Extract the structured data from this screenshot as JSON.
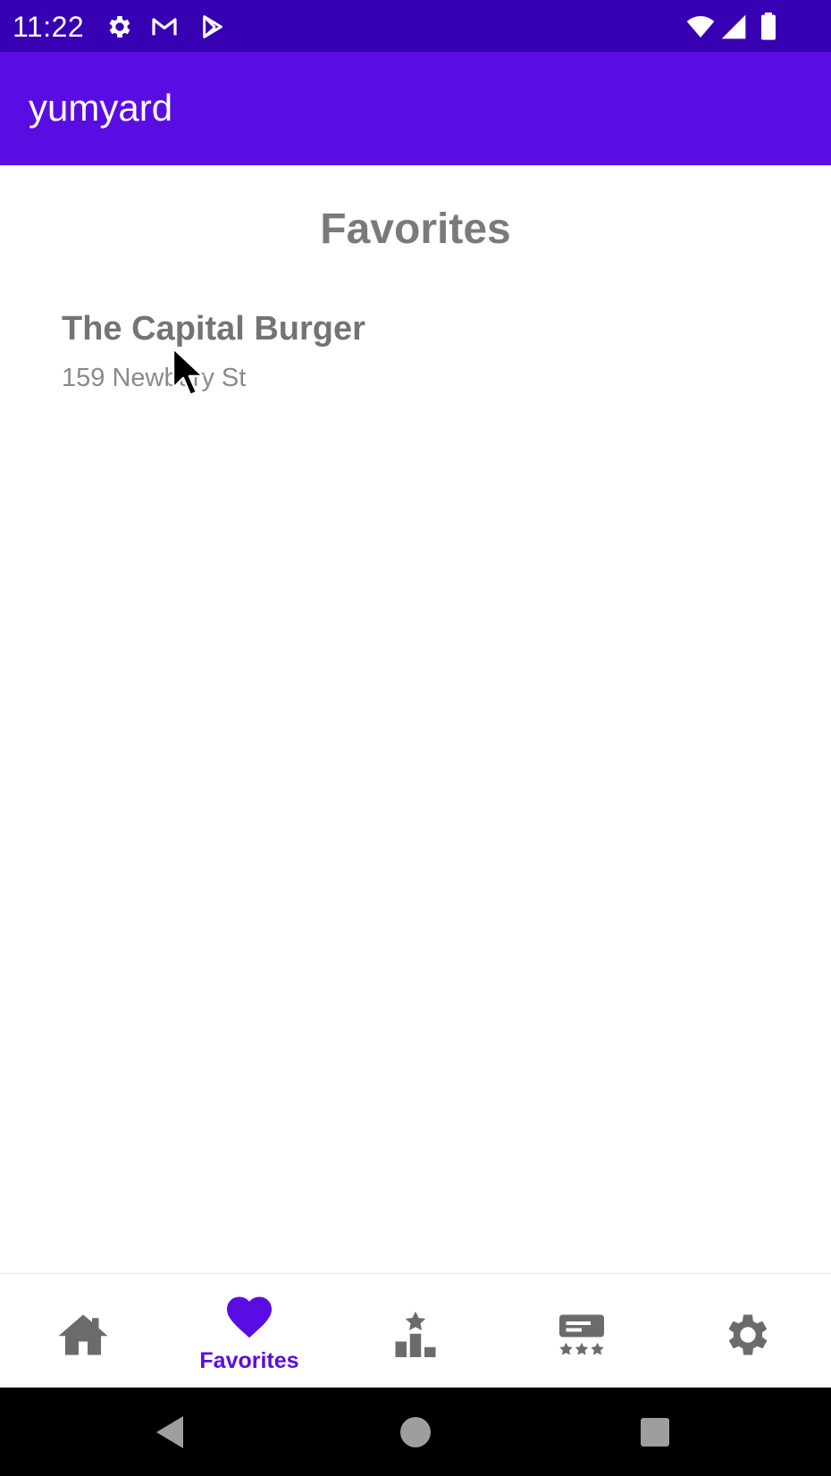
{
  "status_bar": {
    "time": "11:22",
    "icons": [
      "gear-icon",
      "gmail-icon",
      "play-store-icon",
      "wifi-icon",
      "signal-icon",
      "battery-icon"
    ]
  },
  "app_bar": {
    "title": "yumyard",
    "color": "#5a0de3"
  },
  "main": {
    "title": "Favorites",
    "favorites": [
      {
        "name": "The Capital Burger",
        "address": "159 Newbury St"
      }
    ]
  },
  "bottom_nav": {
    "active_color": "#5a0de3",
    "inactive_color": "#6b6b6b",
    "items": [
      {
        "icon": "home-icon",
        "label": "",
        "active": false
      },
      {
        "icon": "heart-icon",
        "label": "Favorites",
        "active": true
      },
      {
        "icon": "leaderboard-icon",
        "label": "",
        "active": false
      },
      {
        "icon": "reviews-icon",
        "label": "",
        "active": false
      },
      {
        "icon": "settings-icon",
        "label": "",
        "active": false
      }
    ]
  },
  "system_nav": {
    "buttons": [
      "back-icon",
      "home-circle-icon",
      "recents-icon"
    ]
  }
}
